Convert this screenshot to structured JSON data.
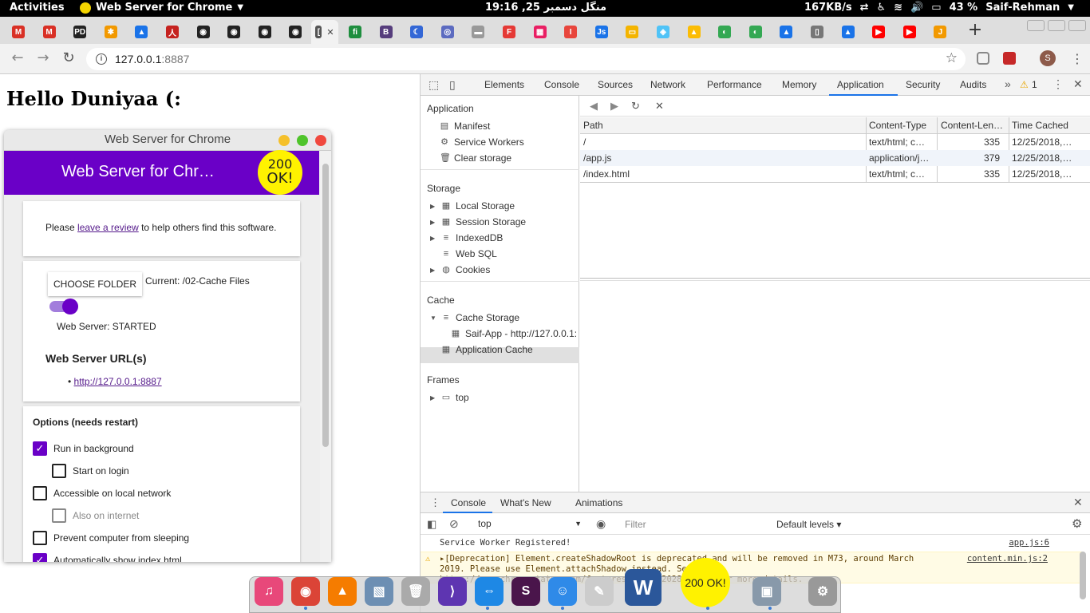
{
  "topbar": {
    "activities": "Activities",
    "app_name": "Web Server for Chrome",
    "clock": "منگل دسمبر 25, 19:16",
    "net_speed": "167KB/s",
    "battery": "43 %",
    "user": "Saif-Rehman"
  },
  "tabs": [
    {
      "glyph": "M",
      "color": "#d93025"
    },
    {
      "glyph": "M",
      "color": "#d93025"
    },
    {
      "glyph": "PD",
      "color": "#222222"
    },
    {
      "glyph": "✱",
      "color": "#f29900"
    },
    {
      "glyph": "▲",
      "color": "#1a73e8"
    },
    {
      "glyph": "人",
      "color": "#c5221f"
    },
    {
      "glyph": "◉",
      "color": "#222222"
    },
    {
      "glyph": "◉",
      "color": "#222222"
    },
    {
      "glyph": "◉",
      "color": "#222222"
    },
    {
      "glyph": "◉",
      "color": "#222222"
    },
    {
      "glyph": "[",
      "color": "#555555",
      "active": true,
      "close": "✕"
    },
    {
      "glyph": "fi",
      "color": "#1e8e3e"
    },
    {
      "glyph": "B",
      "color": "#563d7c"
    },
    {
      "glyph": "☾",
      "color": "#3367d6"
    },
    {
      "glyph": "◎",
      "color": "#5c6bc0"
    },
    {
      "glyph": "▬",
      "color": "#999999"
    },
    {
      "glyph": "F",
      "color": "#e53935"
    },
    {
      "glyph": "▦",
      "color": "#e91e63"
    },
    {
      "glyph": "I",
      "color": "#e8453c"
    },
    {
      "glyph": "Js",
      "color": "#1a73e8"
    },
    {
      "glyph": "▭",
      "color": "#f4b400"
    },
    {
      "glyph": "◈",
      "color": "#4fc3f7"
    },
    {
      "glyph": "▲",
      "color": "#fbbc04"
    },
    {
      "glyph": "◐",
      "color": "#34a853"
    },
    {
      "glyph": "◐",
      "color": "#34a853"
    },
    {
      "glyph": "▲",
      "color": "#1a73e8"
    },
    {
      "glyph": "▯",
      "color": "#777777"
    },
    {
      "glyph": "▲",
      "color": "#1a73e8"
    },
    {
      "glyph": "▶",
      "color": "#ff0000"
    },
    {
      "glyph": "▶",
      "color": "#ff0000"
    },
    {
      "glyph": "J",
      "color": "#f29900"
    }
  ],
  "omnibox": {
    "host": "127.0.0.1",
    "port": ":8887"
  },
  "page": {
    "heading": "Hello Duniyaa (:"
  },
  "webserver": {
    "window_title": "Web Server for Chrome",
    "header_title": "Web Server for Chr…",
    "badge_top": "200",
    "badge_bottom": "OK!",
    "review_before": "Please ",
    "review_link": "leave a review",
    "review_after": " to help others find this software.",
    "choose_folder": "CHOOSE FOLDER",
    "current_folder": "Current: /02-Cache Files",
    "server_status": "Web Server: STARTED",
    "urls_heading": "Web Server URL(s)",
    "url": "http://127.0.0.1:8887",
    "options_heading": "Options (needs restart)",
    "options": [
      {
        "label": "Run in background",
        "checked": true
      },
      {
        "label": "Start on login",
        "checked": false
      },
      {
        "label": "Accessible on local network",
        "checked": false
      },
      {
        "label": "Also on internet",
        "checked": false,
        "disabled": true
      },
      {
        "label": "Prevent computer from sleeping",
        "checked": false
      },
      {
        "label": "Automatically show index.html",
        "checked": true
      }
    ]
  },
  "devtools": {
    "tabs": [
      "Elements",
      "Console",
      "Sources",
      "Network",
      "Performance",
      "Memory",
      "Application",
      "Security",
      "Audits"
    ],
    "active_tab": "Application",
    "more": "»",
    "warning_count": "1",
    "sidebar": {
      "application_title": "Application",
      "application_items": [
        "Manifest",
        "Service Workers",
        "Clear storage"
      ],
      "storage_title": "Storage",
      "storage_items": [
        "Local Storage",
        "Session Storage",
        "IndexedDB",
        "Web SQL",
        "Cookies"
      ],
      "cache_title": "Cache",
      "cache_items": [
        "Cache Storage",
        "Saif-App - http://127.0.0.1:",
        "Application Cache"
      ],
      "frames_title": "Frames",
      "frames_items": [
        "top"
      ]
    },
    "table": {
      "headers": [
        "Path",
        "Content-Type",
        "Content-Len…",
        "Time Cached"
      ],
      "rows": [
        [
          "/",
          "text/html; c…",
          "335",
          "12/25/2018,…"
        ],
        [
          "/app.js",
          "application/j…",
          "379",
          "12/25/2018,…"
        ],
        [
          "/index.html",
          "text/html; c…",
          "335",
          "12/25/2018,…"
        ]
      ]
    },
    "drawer": {
      "tabs": [
        "Console",
        "What's New",
        "Animations"
      ],
      "context": "top",
      "filter_placeholder": "Filter",
      "levels": "Default levels ▾",
      "messages": [
        {
          "text": "Service Worker Registered!",
          "source": "app.js:6",
          "level": "info"
        },
        {
          "text": "▸[Deprecation] Element.createShadowRoot is deprecated and will be removed in M73, around March 2019. Please use Element.attachShadow instead. See https://www.chromestatus.com/features/4507242028072960 for more details.",
          "source": "content.min.js:2",
          "level": "warning"
        }
      ]
    }
  },
  "dock": [
    {
      "name": "itunes-icon",
      "glyph": "♫",
      "color": "#e8487a"
    },
    {
      "name": "chrome-icon",
      "glyph": "◉",
      "color": "#db4437"
    },
    {
      "name": "vlc-icon",
      "glyph": "▲",
      "color": "#f57c00"
    },
    {
      "name": "preview-icon",
      "glyph": "▧",
      "color": "#6d8fb3"
    },
    {
      "name": "trash-icon",
      "glyph": "🗑",
      "color": "#aaaaaa"
    },
    {
      "name": "vscode-icon",
      "glyph": "⟩",
      "color": "#5e35b1"
    },
    {
      "name": "teamviewer-icon",
      "glyph": "⇔",
      "color": "#1e88e5"
    },
    {
      "name": "slack-icon",
      "glyph": "S",
      "color": "#4a154b"
    },
    {
      "name": "finder-icon",
      "glyph": "☺",
      "color": "#2f8ae8"
    },
    {
      "name": "textedit-icon",
      "glyph": "✎",
      "color": "#cccccc"
    },
    {
      "name": "word-icon",
      "glyph": "W",
      "color": "#2b579a"
    },
    {
      "name": "webserver-icon",
      "glyph": "200 OK!",
      "color": "#fff200"
    },
    {
      "name": "screenshot-icon",
      "glyph": "▣",
      "color": "#8899aa"
    },
    {
      "name": "system-icon",
      "glyph": "⚙",
      "color": "#999999"
    }
  ]
}
